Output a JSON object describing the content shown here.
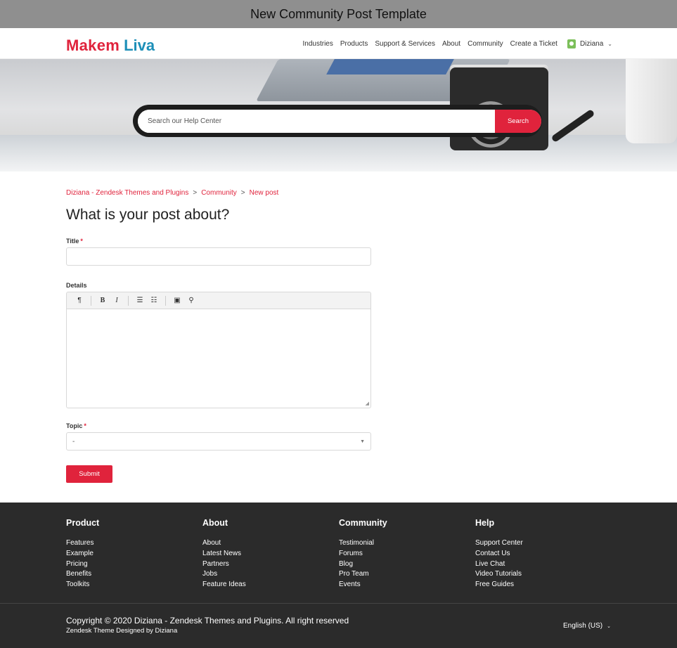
{
  "window_title": "New Community Post Template",
  "header": {
    "logo_part1": "Makem",
    "logo_part2": "Liva",
    "nav": [
      "Industries",
      "Products",
      "Support & Services",
      "About",
      "Community",
      "Create a Ticket"
    ],
    "user_name": "Diziana"
  },
  "hero": {
    "search_placeholder": "Search our Help Center",
    "search_button": "Search"
  },
  "breadcrumb": [
    "Diziana - Zendesk Themes and Plugins",
    "Community",
    "New post"
  ],
  "breadcrumb_separator": ">",
  "form": {
    "heading": "What is your post about?",
    "title_label": "Title",
    "title_value": "",
    "required_mark": "*",
    "details_label": "Details",
    "toolbar": {
      "paragraph": "¶",
      "bold": "B",
      "italic": "I",
      "bullet_list": "☰",
      "numbered_list": "☷",
      "image": "▣",
      "link": "⚲"
    },
    "topic_label": "Topic",
    "topic_value": "-",
    "submit_label": "Submit"
  },
  "footer": {
    "columns": [
      {
        "title": "Product",
        "links": [
          "Features",
          "Example",
          "Pricing",
          "Benefits",
          "Toolkits"
        ]
      },
      {
        "title": "About",
        "links": [
          "About",
          "Latest News",
          "Partners",
          "Jobs",
          "Feature Ideas"
        ]
      },
      {
        "title": "Community",
        "links": [
          "Testimonial",
          "Forums",
          "Blog",
          "Pro Team",
          "Events"
        ]
      },
      {
        "title": "Help",
        "links": [
          "Support Center",
          "Contact Us",
          "Live Chat",
          "Video Tutorials",
          "Free Guides"
        ]
      }
    ],
    "copyright": "Copyright © 2020 Diziana - Zendesk Themes and Plugins. All right reserved",
    "designed_by": "Zendesk Theme Designed by Diziana",
    "language": "English (US)"
  },
  "colors": {
    "accent": "#e0233c",
    "logo_blue": "#1d8fb8",
    "footer_bg": "#2b2b2b"
  },
  "icons": {
    "user": "user-avatar-icon",
    "dropdown": "chevron-down-icon"
  }
}
